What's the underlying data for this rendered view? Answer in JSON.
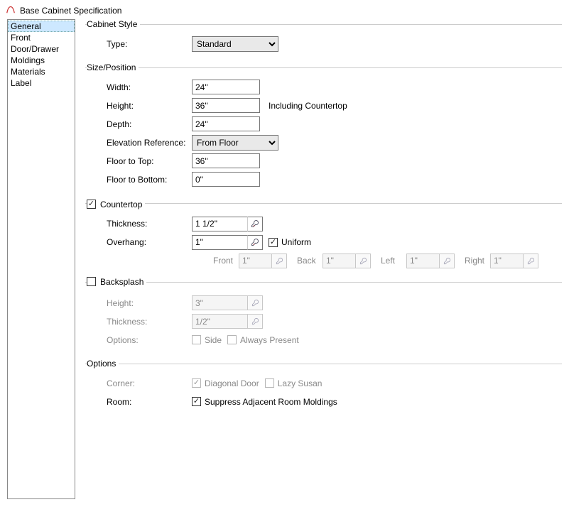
{
  "window": {
    "title": "Base Cabinet Specification"
  },
  "sidebar": {
    "items": [
      {
        "label": "General"
      },
      {
        "label": "Front"
      },
      {
        "label": "Door/Drawer"
      },
      {
        "label": "Moldings"
      },
      {
        "label": "Materials"
      },
      {
        "label": "Label"
      }
    ]
  },
  "cabinet_style": {
    "legend": "Cabinet Style",
    "type_label": "Type:",
    "type_value": "Standard"
  },
  "size_position": {
    "legend": "Size/Position",
    "width_label": "Width:",
    "width_value": "24\"",
    "height_label": "Height:",
    "height_value": "36\"",
    "height_aux": "Including Countertop",
    "depth_label": "Depth:",
    "depth_value": "24\"",
    "elev_ref_label": "Elevation Reference:",
    "elev_ref_value": "From Floor",
    "floor_top_label": "Floor to Top:",
    "floor_top_value": "36\"",
    "floor_bottom_label": "Floor to Bottom:",
    "floor_bottom_value": "0\""
  },
  "countertop": {
    "legend": "Countertop",
    "thickness_label": "Thickness:",
    "thickness_value": "1 1/2\"",
    "overhang_label": "Overhang:",
    "overhang_value": "1\"",
    "uniform_label": "Uniform",
    "front_label": "Front",
    "front_value": "1\"",
    "back_label": "Back",
    "back_value": "1\"",
    "left_label": "Left",
    "left_value": "1\"",
    "right_label": "Right",
    "right_value": "1\""
  },
  "backsplash": {
    "legend": "Backsplash",
    "height_label": "Height:",
    "height_value": "3\"",
    "thickness_label": "Thickness:",
    "thickness_value": "1/2\"",
    "options_label": "Options:",
    "side_label": "Side",
    "always_label": "Always Present"
  },
  "options": {
    "legend": "Options",
    "corner_label": "Corner:",
    "diagonal_label": "Diagonal Door",
    "lazy_label": "Lazy Susan",
    "room_label": "Room:",
    "suppress_label": "Suppress Adjacent Room Moldings"
  }
}
